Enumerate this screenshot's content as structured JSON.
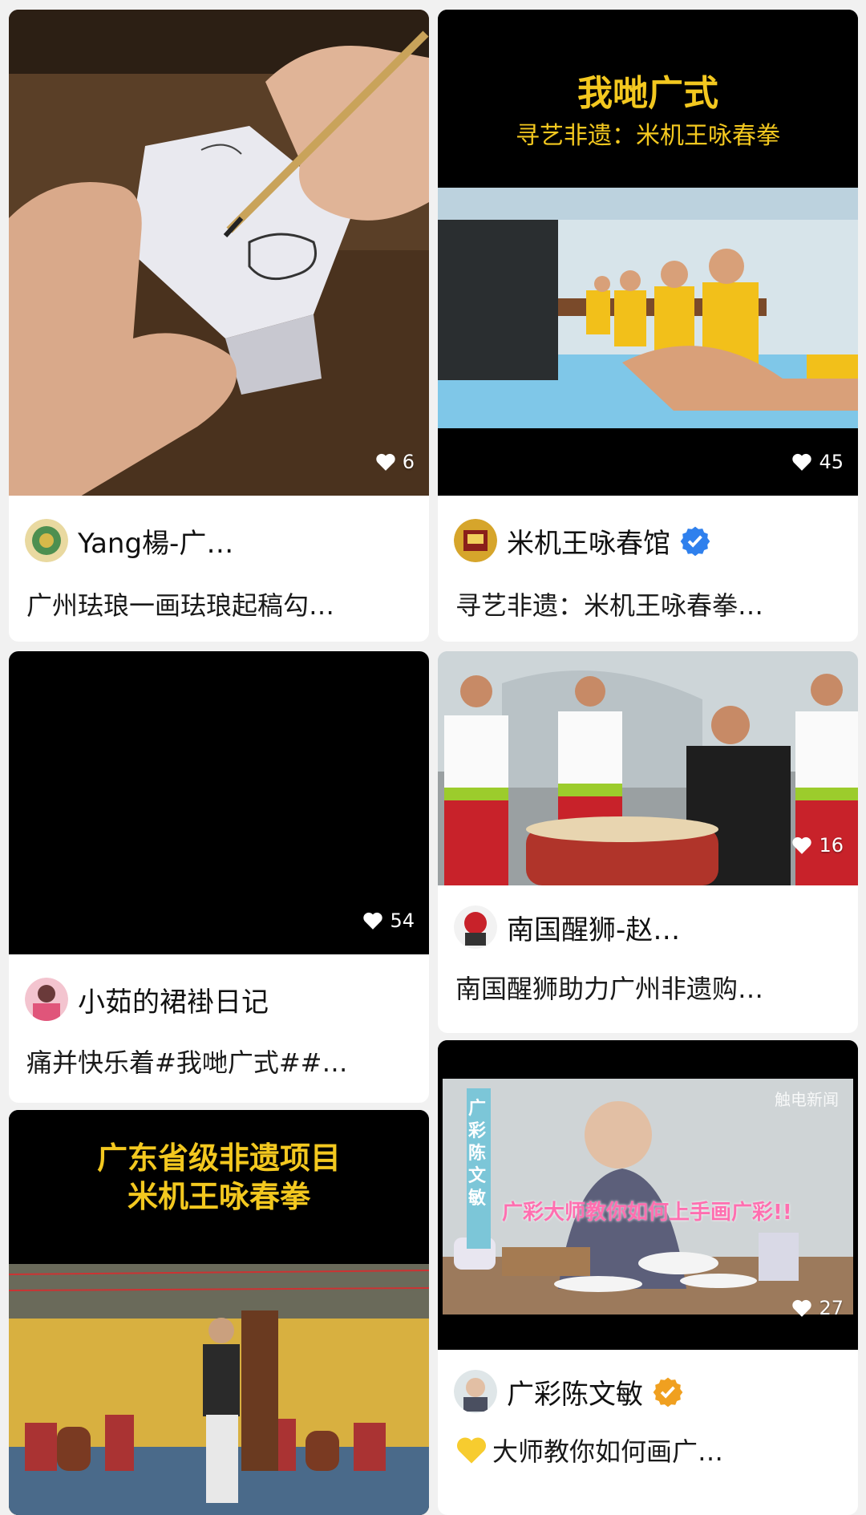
{
  "feed": {
    "cards": [
      {
        "id": "card-1",
        "likes": "6",
        "author": "Yang楊-广…",
        "verified": false,
        "description": "广州珐琅一画珐琅起稿勾…"
      },
      {
        "id": "card-2",
        "likes": "45",
        "author": "米机王咏春馆",
        "verified": true,
        "verified_color": "#2f80ed",
        "overlay_title": "我哋广式",
        "overlay_subtitle": "寻艺非遗：米机王咏春拳",
        "description": "寻艺非遗：米机王咏春拳…"
      },
      {
        "id": "card-3",
        "likes": "54",
        "author": "小茹的裙褂日记",
        "verified": false,
        "description": "痛并快乐着#我哋广式##…"
      },
      {
        "id": "card-4",
        "likes": "16",
        "author": "南国醒狮-赵…",
        "verified": false,
        "description": "南国醒狮助力广州非遗购…"
      },
      {
        "id": "card-5",
        "overlay_title_line1": "广东省级非遗项目",
        "overlay_title_line2": "米机王咏春拳"
      },
      {
        "id": "card-6",
        "likes": "27",
        "author": "广彩陈文敏",
        "verified": true,
        "verified_color": "#f0a020",
        "overlay_caption": "广彩大师教你如何上手画广彩!!",
        "side_banner": "广彩陈文敏",
        "watermark": "触电新闻",
        "description": "大师教你如何画广…"
      }
    ],
    "icons": {
      "heart": "heart-icon",
      "verified": "verified-badge-icon",
      "emoji": "yellow-heart-emoji"
    }
  }
}
